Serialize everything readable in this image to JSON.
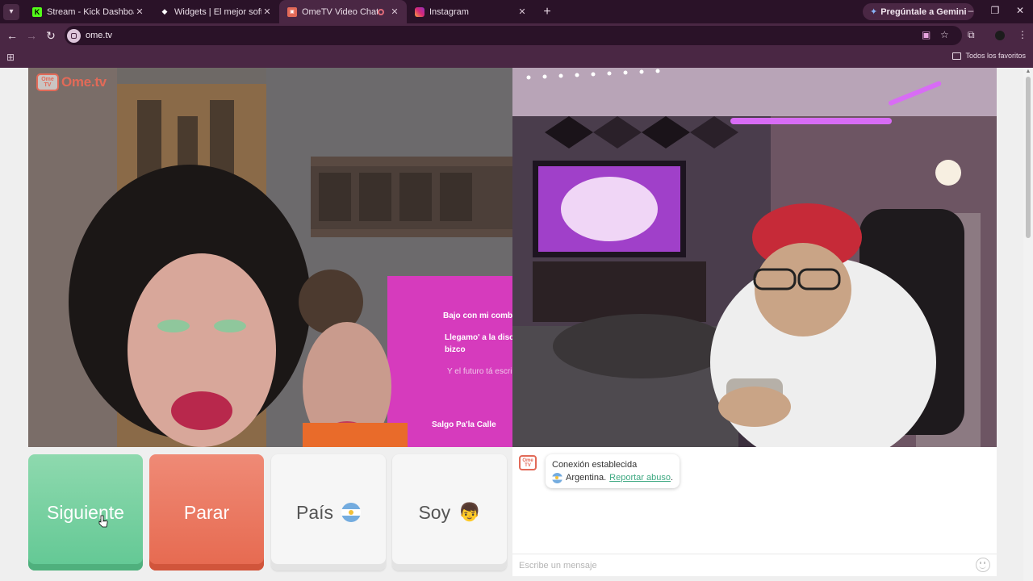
{
  "browser": {
    "tabs": [
      {
        "title": "Stream - Kick Dashboard",
        "icon": "kick-icon",
        "active": false
      },
      {
        "title": "Widgets | El mejor software para",
        "icon": "widgets-icon",
        "active": false
      },
      {
        "title": "OmeTV Video Chat — Ome",
        "icon": "ometv-icon",
        "active": true
      },
      {
        "title": "Instagram",
        "icon": "instagram-icon",
        "active": false
      }
    ],
    "gemini_label": "Pregúntale a Gemini",
    "url": "ome.tv",
    "favorites_label": "Todos los favoritos"
  },
  "page": {
    "logo_text": "Ome.tv",
    "logo_badge": "Ome TV",
    "buttons": {
      "next": "Siguiente",
      "stop": "Parar",
      "country": "País",
      "soy": "Soy"
    },
    "chat": {
      "status": "Conexión establecida",
      "country": "Argentina.",
      "report_link": "Reportar abuso",
      "report_suffix": ".",
      "input_placeholder": "Escribe un mensaje"
    },
    "video_screen_text": {
      "line1": "Bajo con mi combo a",
      "line2": "Llegamo' a la disco",
      "line3": "bizco",
      "line4": "Y el futuro tá escri",
      "brand": "Salgo Pa'la Calle"
    }
  },
  "colors": {
    "next_green": "#62c894",
    "stop_red": "#e6694f",
    "brand_orange": "#e26a58",
    "link_green": "#3fa982",
    "chrome_dark": "#2a1228",
    "chrome_mid": "#4a2744"
  }
}
